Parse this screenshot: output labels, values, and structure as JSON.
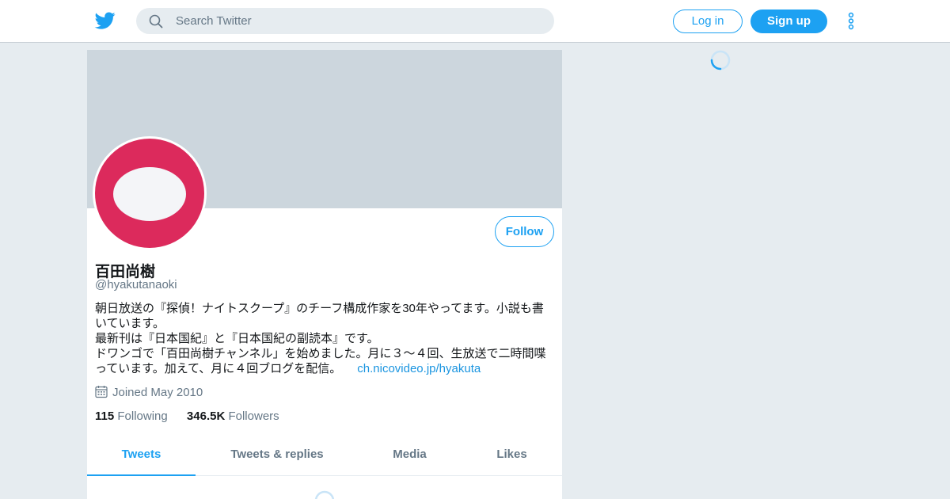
{
  "header": {
    "logo_icon": "twitter-bird-icon",
    "search": {
      "placeholder": "Search Twitter",
      "icon": "search-icon"
    },
    "login_label": "Log in",
    "signup_label": "Sign up",
    "more_icon": "more-vertical-icon"
  },
  "profile": {
    "name": "百田尚樹",
    "handle": "@hyakutanaoki",
    "follow_label": "Follow",
    "bio": [
      "朝日放送の『探偵！ナイトスクープ』のチーフ構成作家を30年やってます。小説も書いています。",
      "最新刊は『日本国紀』と『日本国紀の副読本』です。",
      " ドワンゴで「百田尚樹チャンネル」を始めました。月に３～４回、生放送で二時間喋っています。加えて、月に４回ブログを配信。"
    ],
    "link": "ch.nicovideo.jp/hyakuta",
    "joined": "Joined May 2010",
    "following_count": "115",
    "following_label": "Following",
    "followers_count": "346.5K",
    "followers_label": "Followers"
  },
  "tabs": [
    {
      "label": "Tweets",
      "active": true
    },
    {
      "label": "Tweets & replies",
      "active": false
    },
    {
      "label": "Media",
      "active": false
    },
    {
      "label": "Likes",
      "active": false
    }
  ],
  "colors": {
    "brand": "#1da1f2",
    "avatar": "#dc2a5c",
    "banner": "#ccd6dd",
    "background": "#e6ecf0"
  }
}
